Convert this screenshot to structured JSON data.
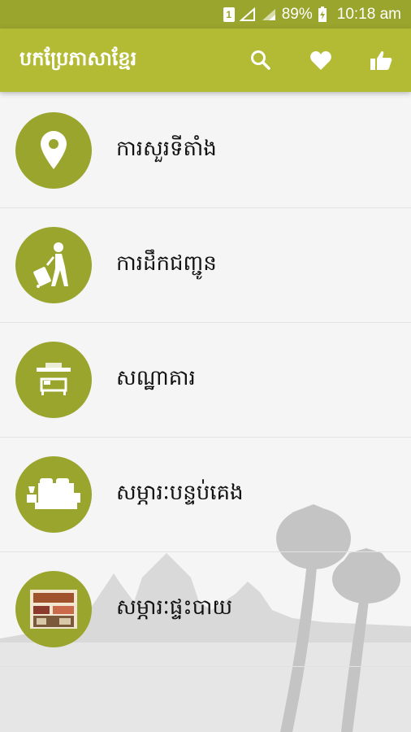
{
  "status_bar": {
    "sim_label": "1",
    "battery": "89%",
    "time": "10:18 am"
  },
  "app_bar": {
    "title": "បកប្រែភាសាខ្មែរ",
    "actions": [
      "search-icon",
      "heart-icon",
      "thumbs-up-icon"
    ]
  },
  "menu": {
    "items": [
      {
        "label": "ការសួរទីតាំង",
        "icon": "location-pin-icon"
      },
      {
        "label": "ការដឹកជញ្ជូន",
        "icon": "traveler-icon"
      },
      {
        "label": "សណ្ឋាគារ",
        "icon": "hotel-icon"
      },
      {
        "label": "សម្ភារៈបន្ទប់គេង",
        "icon": "bedroom-icon"
      },
      {
        "label": "សម្ភារៈផ្ទះបាយ",
        "icon": "kitchen-icon"
      }
    ]
  },
  "colors": {
    "status_bar": "#9aa52d",
    "app_bar": "#b3bb35",
    "icon_circle": "#9aa52d",
    "background": "#f5f5f5"
  }
}
